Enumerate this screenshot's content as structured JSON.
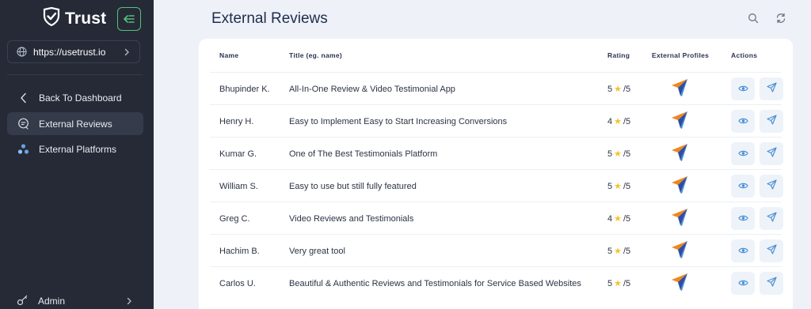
{
  "brand": {
    "name": "Trust"
  },
  "sidebar": {
    "site": "https://usetrust.io",
    "nav": [
      {
        "label": "Back To Dashboard",
        "icon": "chevron-left-icon"
      },
      {
        "label": "External Reviews",
        "icon": "reviews-icon",
        "active": true
      },
      {
        "label": "External Platforms",
        "icon": "platforms-icon"
      }
    ],
    "admin": "Admin"
  },
  "page": {
    "title": "External Reviews",
    "header_icons": [
      "search-icon",
      "refresh-icon"
    ]
  },
  "table": {
    "headers": {
      "name": "Name",
      "title": "Title (eg. name)",
      "rating": "Rating",
      "profiles": "External Profiles",
      "actions": "Actions"
    },
    "rating_suffix": "/5",
    "rows": [
      {
        "name": "Bhupinder K.",
        "title": "All-In-One Review & Video Testimonial App",
        "rating": "5"
      },
      {
        "name": "Henry H.",
        "title": "Easy to Implement Easy to Start Increasing Conversions",
        "rating": "4"
      },
      {
        "name": "Kumar G.",
        "title": "One of The Best Testimonials Platform",
        "rating": "5"
      },
      {
        "name": "William S.",
        "title": "Easy to use but still fully featured",
        "rating": "5"
      },
      {
        "name": "Greg C.",
        "title": "Video Reviews and Testimonials",
        "rating": "4"
      },
      {
        "name": "Hachim B.",
        "title": "Very great tool",
        "rating": "5"
      },
      {
        "name": "Carlos U.",
        "title": "Beautiful & Authentic Reviews and Testimonials for Service Based Websites",
        "rating": "5"
      }
    ]
  },
  "colors": {
    "sidebar_bg": "#252a36",
    "accent_green": "#54c27a",
    "page_bg": "#eef2f8",
    "star": "#f2c230",
    "action_icon": "#4a8fd6"
  }
}
